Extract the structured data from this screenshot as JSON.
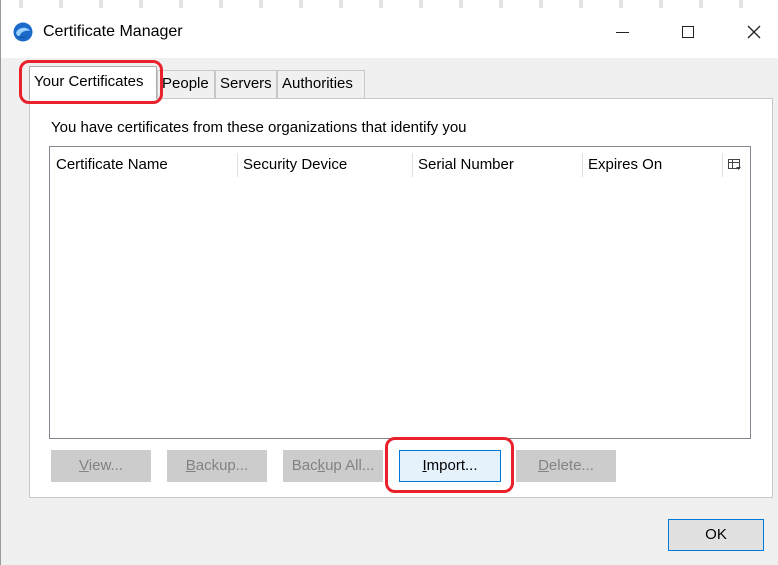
{
  "window": {
    "title": "Certificate Manager",
    "minimize_glyph": "—",
    "close_glyph": "✕"
  },
  "tabs": [
    {
      "label": "Your Certificates",
      "active": true
    },
    {
      "label": "People",
      "active": false
    },
    {
      "label": "Servers",
      "active": false
    },
    {
      "label": "Authorities",
      "active": false
    }
  ],
  "panel": {
    "intro": "You have certificates from these organizations that identify you",
    "columns": [
      "Certificate Name",
      "Security Device",
      "Serial Number",
      "Expires On"
    ],
    "rows": []
  },
  "buttons": {
    "view": {
      "pre": "",
      "accel": "V",
      "post": "iew..."
    },
    "backup": {
      "pre": "",
      "accel": "B",
      "post": "ackup..."
    },
    "backup_all": {
      "pre": "Bac",
      "accel": "k",
      "post": "up All..."
    },
    "import": {
      "pre": "",
      "accel": "I",
      "post": "mport..."
    },
    "delete": {
      "pre": "",
      "accel": "D",
      "post": "elete..."
    },
    "ok": "OK"
  },
  "icons": {
    "app": "thunderbird-icon",
    "column_picker": "column-picker-icon",
    "minimize": "minimize-icon",
    "maximize": "maximize-icon",
    "close": "close-icon"
  },
  "colors": {
    "highlight": "#e8212a",
    "accent": "#0078d7",
    "disabled_button": "#cccccc",
    "disabled_text": "#838383",
    "import_button": "#e5f1fb"
  }
}
